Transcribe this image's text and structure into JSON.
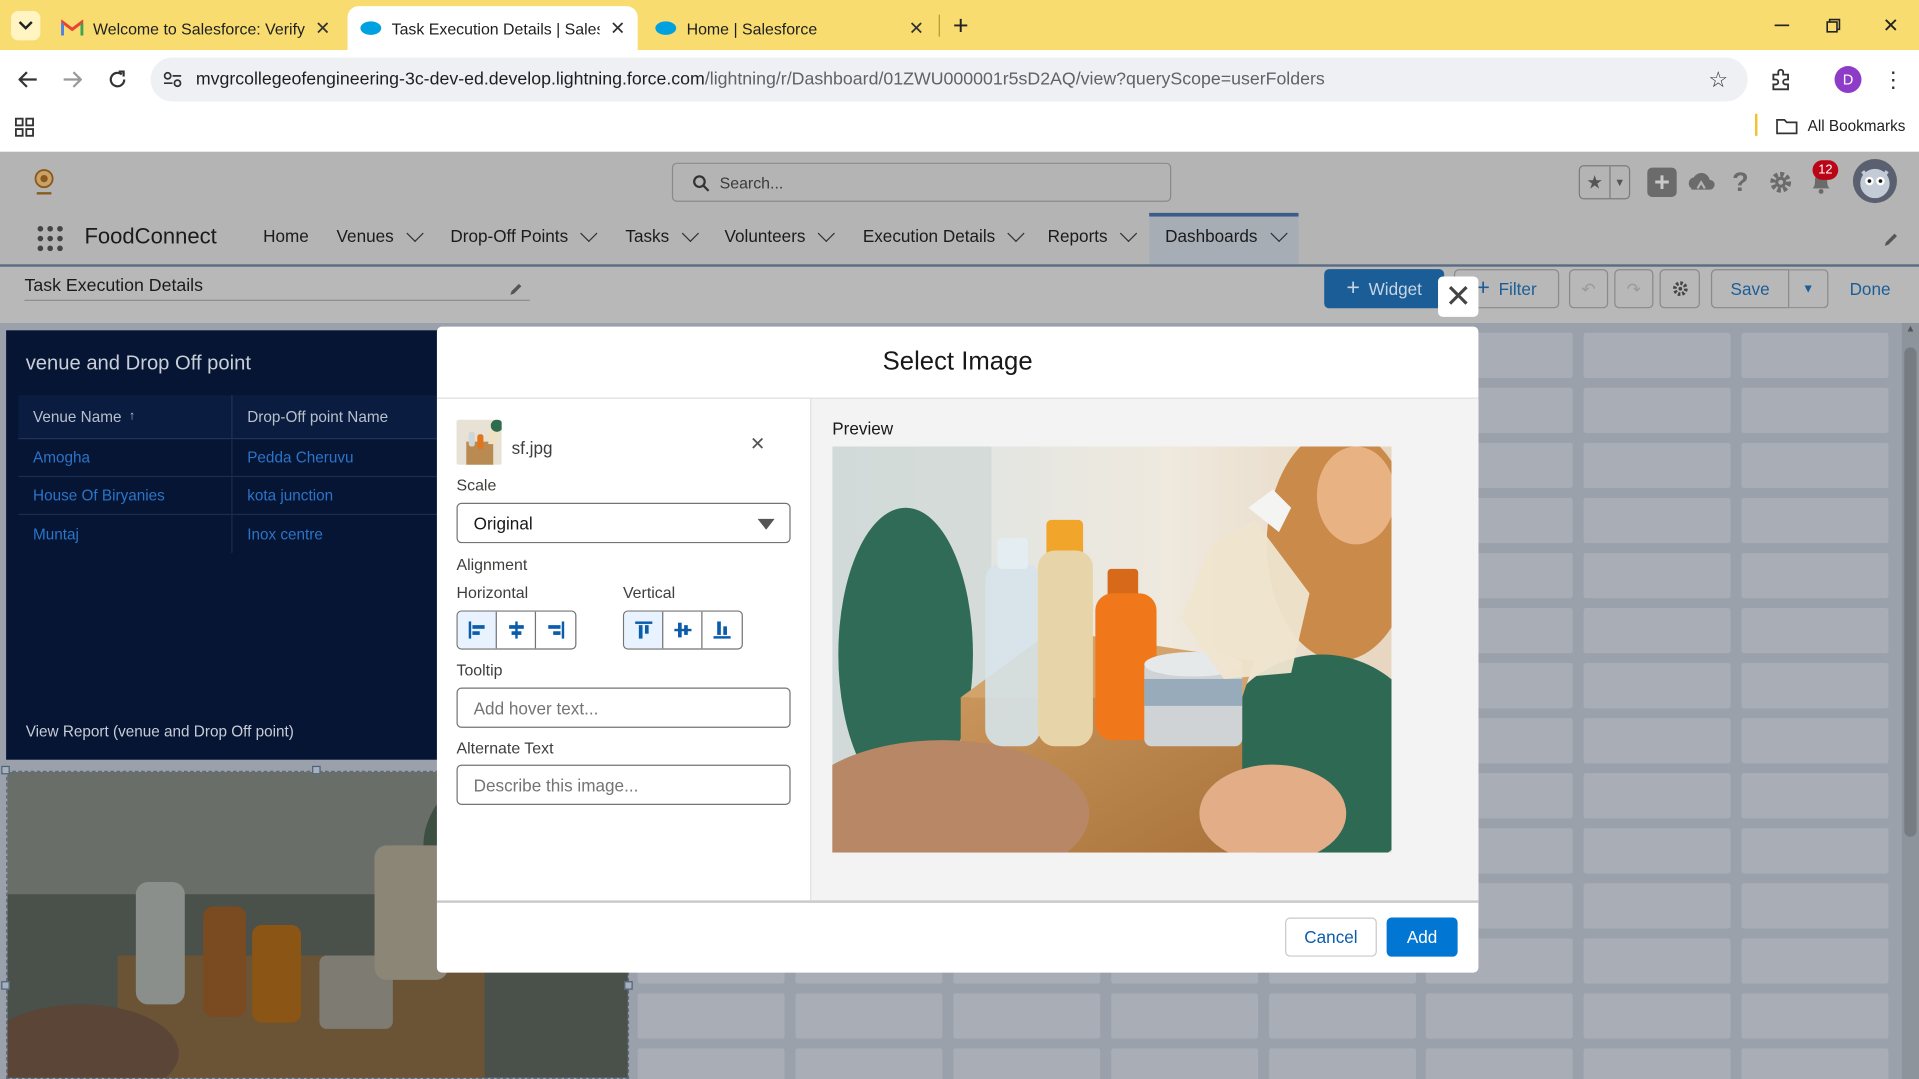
{
  "browser": {
    "tabs": [
      {
        "title": "Welcome to Salesforce: Verify y",
        "icon": "gmail-icon",
        "active": false
      },
      {
        "title": "Task Execution Details | Salesfor",
        "icon": "salesforce-cloud-icon",
        "active": true
      },
      {
        "title": "Home | Salesforce",
        "icon": "salesforce-cloud-icon",
        "active": false
      }
    ],
    "url_host": "mvgrcollegeofengineering-3c-dev-ed.develop.lightning.force.com",
    "url_path": "/lightning/r/Dashboard/01ZWU000001r5sD2AQ/view?queryScope=userFolders",
    "profile_initial": "D",
    "all_bookmarks": "All Bookmarks"
  },
  "sf": {
    "search_placeholder": "Search...",
    "app_name": "FoodConnect",
    "notification_count": "12",
    "nav": [
      {
        "label": "Home",
        "has_menu": false
      },
      {
        "label": "Venues",
        "has_menu": true
      },
      {
        "label": "Drop-Off Points",
        "has_menu": true
      },
      {
        "label": "Tasks",
        "has_menu": true
      },
      {
        "label": "Volunteers",
        "has_menu": true
      },
      {
        "label": "Execution Details",
        "has_menu": true
      },
      {
        "label": "Reports",
        "has_menu": true
      },
      {
        "label": "Dashboards",
        "has_menu": true,
        "active": true
      }
    ],
    "dashboard_title": "Task Execution Details",
    "toolbar": {
      "widget": "Widget",
      "filter": "Filter",
      "save": "Save",
      "done": "Done"
    },
    "widget": {
      "title": "venue and Drop Off point",
      "columns": [
        "Venue Name",
        "Drop-Off point Name"
      ],
      "rows": [
        [
          "Amogha",
          "Pedda Cheruvu"
        ],
        [
          "House Of Biryanies",
          "kota junction"
        ],
        [
          "Muntaj",
          "Inox centre"
        ]
      ],
      "footer_link": "View Report (venue and Drop Off point)"
    }
  },
  "modal": {
    "title": "Select Image",
    "file_name": "sf.jpg",
    "scale_label": "Scale",
    "scale_value": "Original",
    "alignment_label": "Alignment",
    "horizontal_label": "Horizontal",
    "vertical_label": "Vertical",
    "tooltip_label": "Tooltip",
    "tooltip_placeholder": "Add hover text...",
    "alt_label": "Alternate Text",
    "alt_placeholder": "Describe this image...",
    "preview_label": "Preview",
    "cancel": "Cancel",
    "add": "Add"
  },
  "colors": {
    "tabstrip": "#f8dc6f",
    "sf_blue": "#0176d3",
    "widget_bg": "#061533",
    "notification_red": "#ba0517"
  }
}
